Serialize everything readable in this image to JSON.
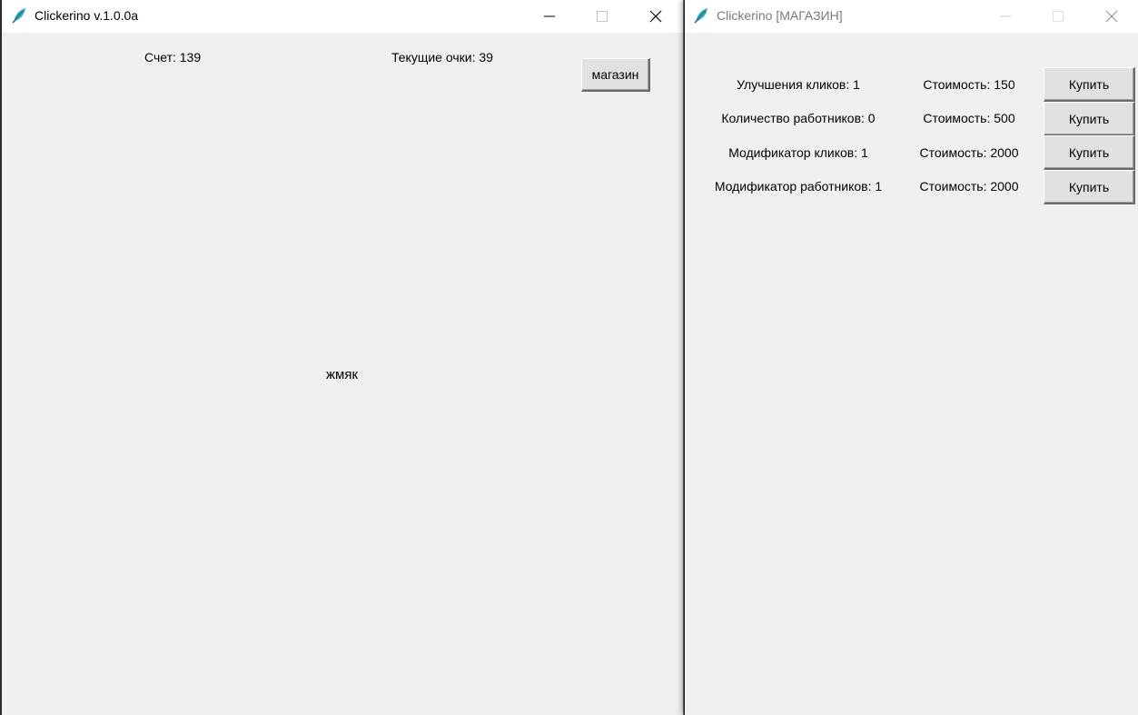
{
  "main_window": {
    "title": "Clickerino v.1.0.0a",
    "score_label": "Счет: 139",
    "current_points_label": "Текущие очки: 39",
    "shop_button": "магазин",
    "click_target": "жмяк"
  },
  "shop_window": {
    "title": "Clickerino [МАГАЗИН]",
    "items": [
      {
        "name": "Улучшения кликов: 1",
        "cost": "Стоимость: 150",
        "buy": "Купить"
      },
      {
        "name": "Количество работников: 0",
        "cost": "Стоимость: 500",
        "buy": "Купить"
      },
      {
        "name": "Модификатор кликов: 1",
        "cost": "Стоимость: 2000",
        "buy": "Купить"
      },
      {
        "name": "Модификатор работников: 1",
        "cost": "Стоимость: 2000",
        "buy": "Купить"
      }
    ]
  },
  "icons": {
    "app": "feather-icon",
    "minimize": "minimize-icon",
    "maximize": "maximize-icon",
    "close": "close-icon"
  },
  "colors": {
    "window_bg": "#f0f0f0",
    "titlebar_bg": "#ffffff",
    "icon_teal": "#2bb3a7",
    "icon_blue": "#2f6fb7"
  }
}
